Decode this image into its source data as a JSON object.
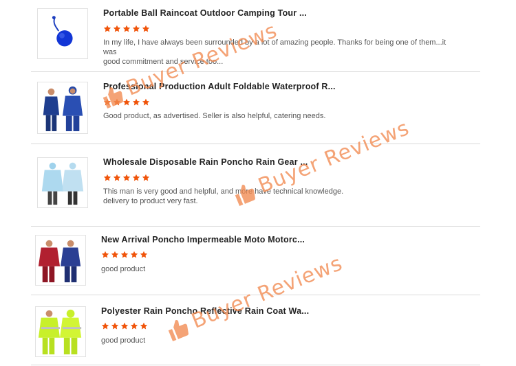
{
  "reviews": [
    {
      "title": "Portable Ball Raincoat Outdoor Camping Tour ...",
      "rating": 5,
      "review_lines": [
        "In my life, I have always been surrounded by a lot of amazing people. Thanks for being one of them...it was",
        "good commitment and service too..."
      ]
    },
    {
      "title": "Professional Production Adult Foldable Waterproof R...",
      "rating": 5,
      "review_lines": [
        "Good product, as advertised. Seller is also helpful, catering needs."
      ]
    },
    {
      "title": "Wholesale Disposable Rain Poncho Rain Gear ...",
      "rating": 5,
      "review_lines": [
        "This man is very good and helpful, and more have technical knowledge.",
        "delivery to product very fast."
      ]
    },
    {
      "title": "New Arrival Poncho Impermeable Moto Motorc...",
      "rating": 5,
      "review_lines": [
        "good product"
      ]
    },
    {
      "title": "Polyester Rain Poncho Reflective Rain Coat Wa...",
      "rating": 5,
      "review_lines": [
        "good product"
      ]
    }
  ],
  "watermark": {
    "text": "Buyer Reviews",
    "color": "#f28a50"
  },
  "colors": {
    "star": "#f0540a",
    "divider": "#d9d9d9"
  }
}
